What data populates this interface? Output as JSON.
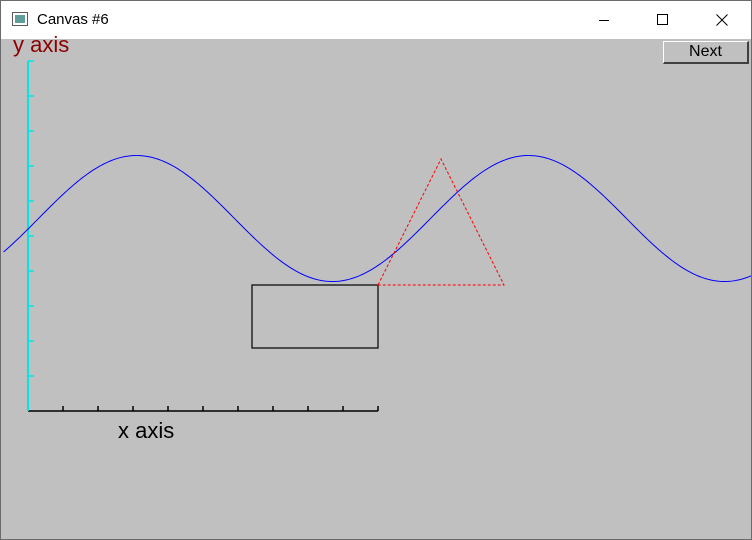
{
  "window": {
    "title": "Canvas #6",
    "icon": "canvas-app-icon",
    "controls": [
      "minimize-icon",
      "maximize-icon",
      "close-icon"
    ]
  },
  "toolbar": {
    "next_label": "Next"
  },
  "colors": {
    "canvas_bg": "#c0c0c0",
    "y_axis": "#00e5e5",
    "x_axis": "#000000",
    "sine": "#0000ff",
    "triangle": "#ff0000",
    "rectangle": "#000000",
    "ylabel": "#8b0000"
  },
  "chart_data": {
    "type": "line",
    "title": "",
    "xlabel": "x axis",
    "ylabel": "y axis",
    "xlim": [
      0,
      10
    ],
    "ylim": [
      0,
      10
    ],
    "x_ticks": 10,
    "y_ticks": 10,
    "grid": false,
    "series": [
      {
        "values_function": "sine",
        "x_range": [
          -0.7,
          20.7
        ],
        "center": 5.5,
        "amplitude": 1.8,
        "period": 11.2,
        "phase_x": 0.3
      }
    ],
    "shapes": [
      {
        "kind": "triangle",
        "style": "dashed",
        "points": [
          [
            10,
            3.6
          ],
          [
            11.8,
            7.2
          ],
          [
            13.6,
            3.6
          ]
        ]
      },
      {
        "kind": "rectangle",
        "style": "solid",
        "x": [
          6.4,
          10
        ],
        "y": [
          1.8,
          3.6
        ]
      }
    ]
  }
}
